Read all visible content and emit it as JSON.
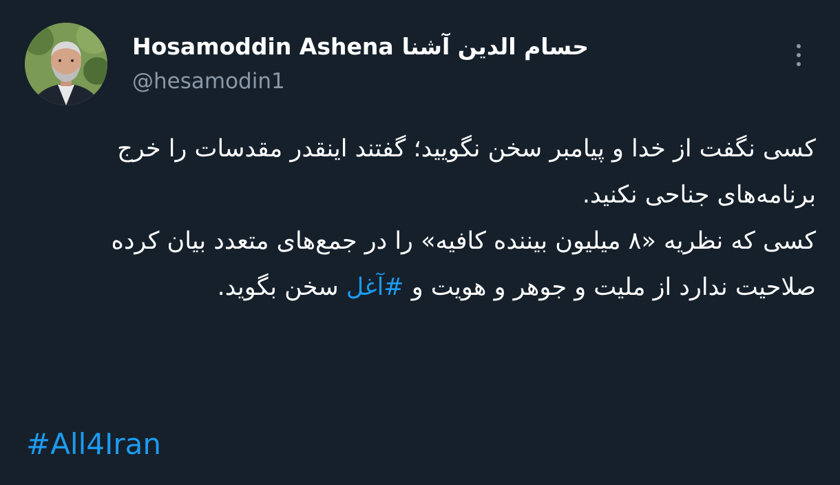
{
  "tweet": {
    "author": {
      "name_en": "Hosamoddin Ashena",
      "name_fa": "حسام الدین آشنا",
      "handle": "@hesamodin1"
    },
    "more_icon": "more-vertical-icon",
    "text": {
      "para1": "کسی نگفت از خدا و پیامبر سخن نگویید؛ گفتند اینقدر مقدسات را خرج برنامه‌های جناحی نکنید.",
      "para2_before": "کسی که نظریه «۸ میلیون بیننده کافیه» را در جمع‌های متعدد بیان کرده صلاحیت ندارد از ملیت و جوهر و هویت و ",
      "para2_hashtag": "#آغل",
      "para2_after": " سخن بگوید."
    },
    "hashtag_en": "#All4Iran"
  },
  "colors": {
    "background": "#15202b",
    "text": "#ffffff",
    "secondary": "#8b98a5",
    "link": "#1d9bf0"
  }
}
